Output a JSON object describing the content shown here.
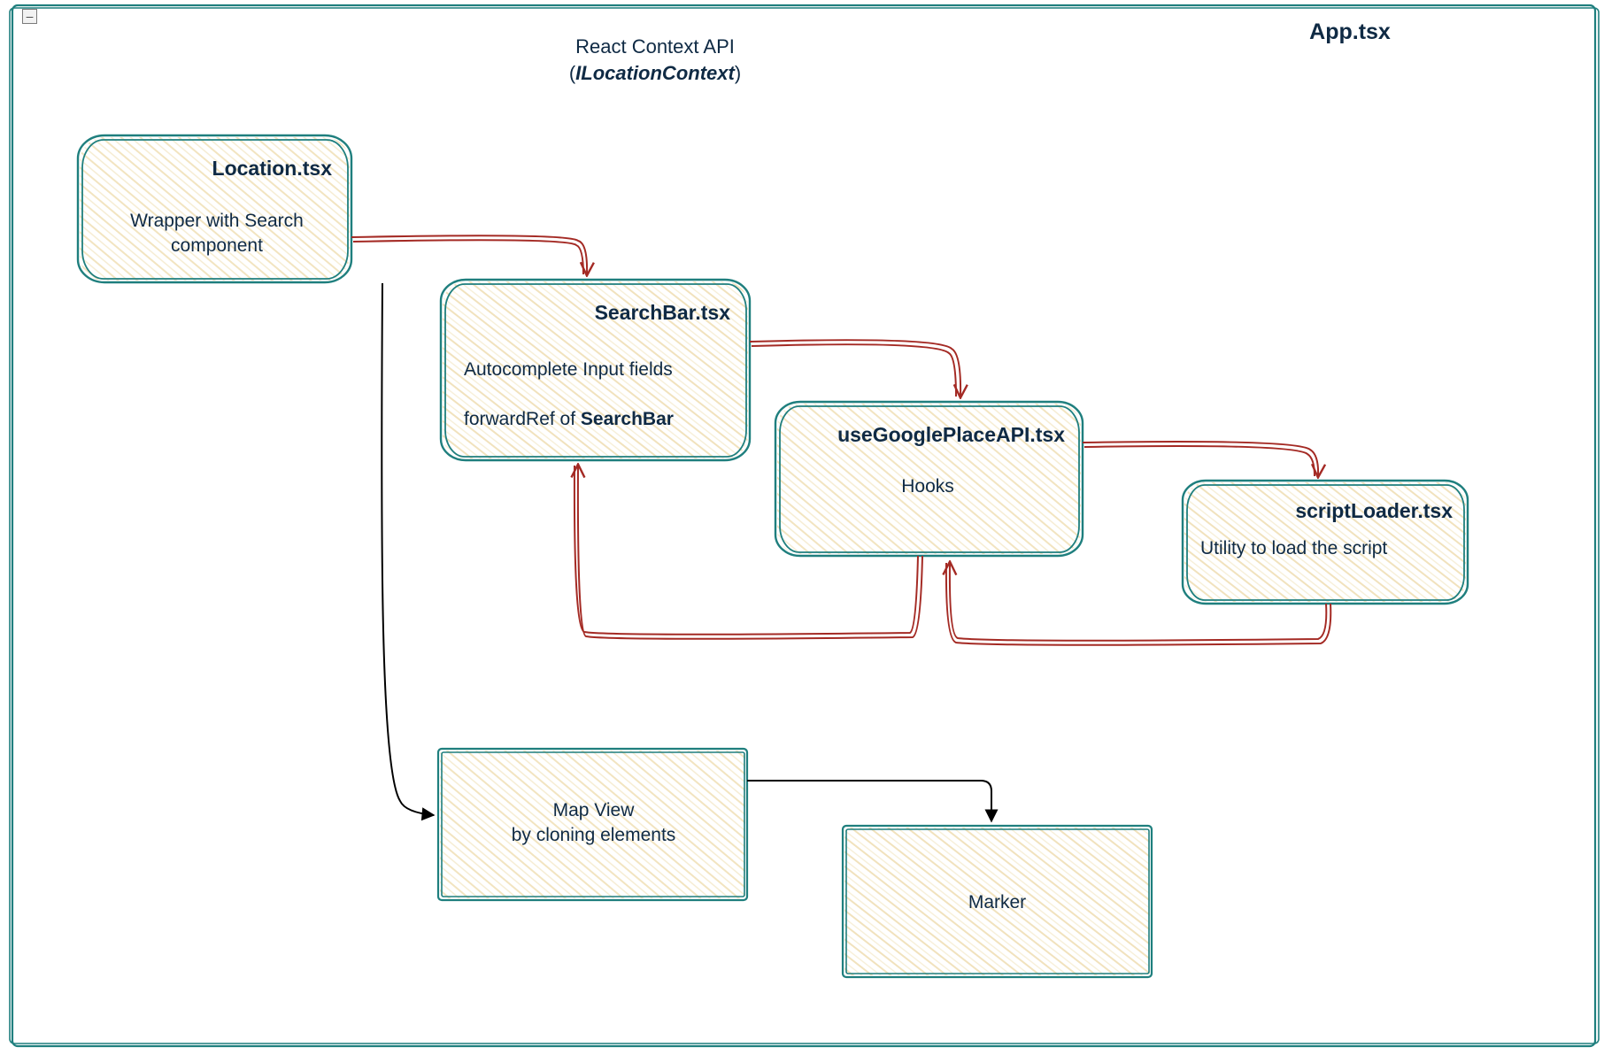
{
  "frame": {
    "title": "App.tsx"
  },
  "context": {
    "line1": "React Context API",
    "line2_open": "(",
    "line2_name": "ILocationContext",
    "line2_close": ")"
  },
  "nodes": {
    "location": {
      "title": "Location.tsx",
      "desc": "Wrapper with Search component"
    },
    "searchbar": {
      "title": "SearchBar.tsx",
      "desc1": "Autocomplete Input fields",
      "desc2_pre": "forwardRef of ",
      "desc2_strong": "SearchBar"
    },
    "useapi": {
      "title": "useGooglePlaceAPI.tsx",
      "desc": "Hooks"
    },
    "scriptloader": {
      "title": "scriptLoader.tsx",
      "desc": "Utility to load the script"
    },
    "mapview": {
      "line1": "Map View",
      "line2": "by cloning elements"
    },
    "marker": {
      "title": "Marker"
    }
  },
  "collapse_glyph": "–"
}
